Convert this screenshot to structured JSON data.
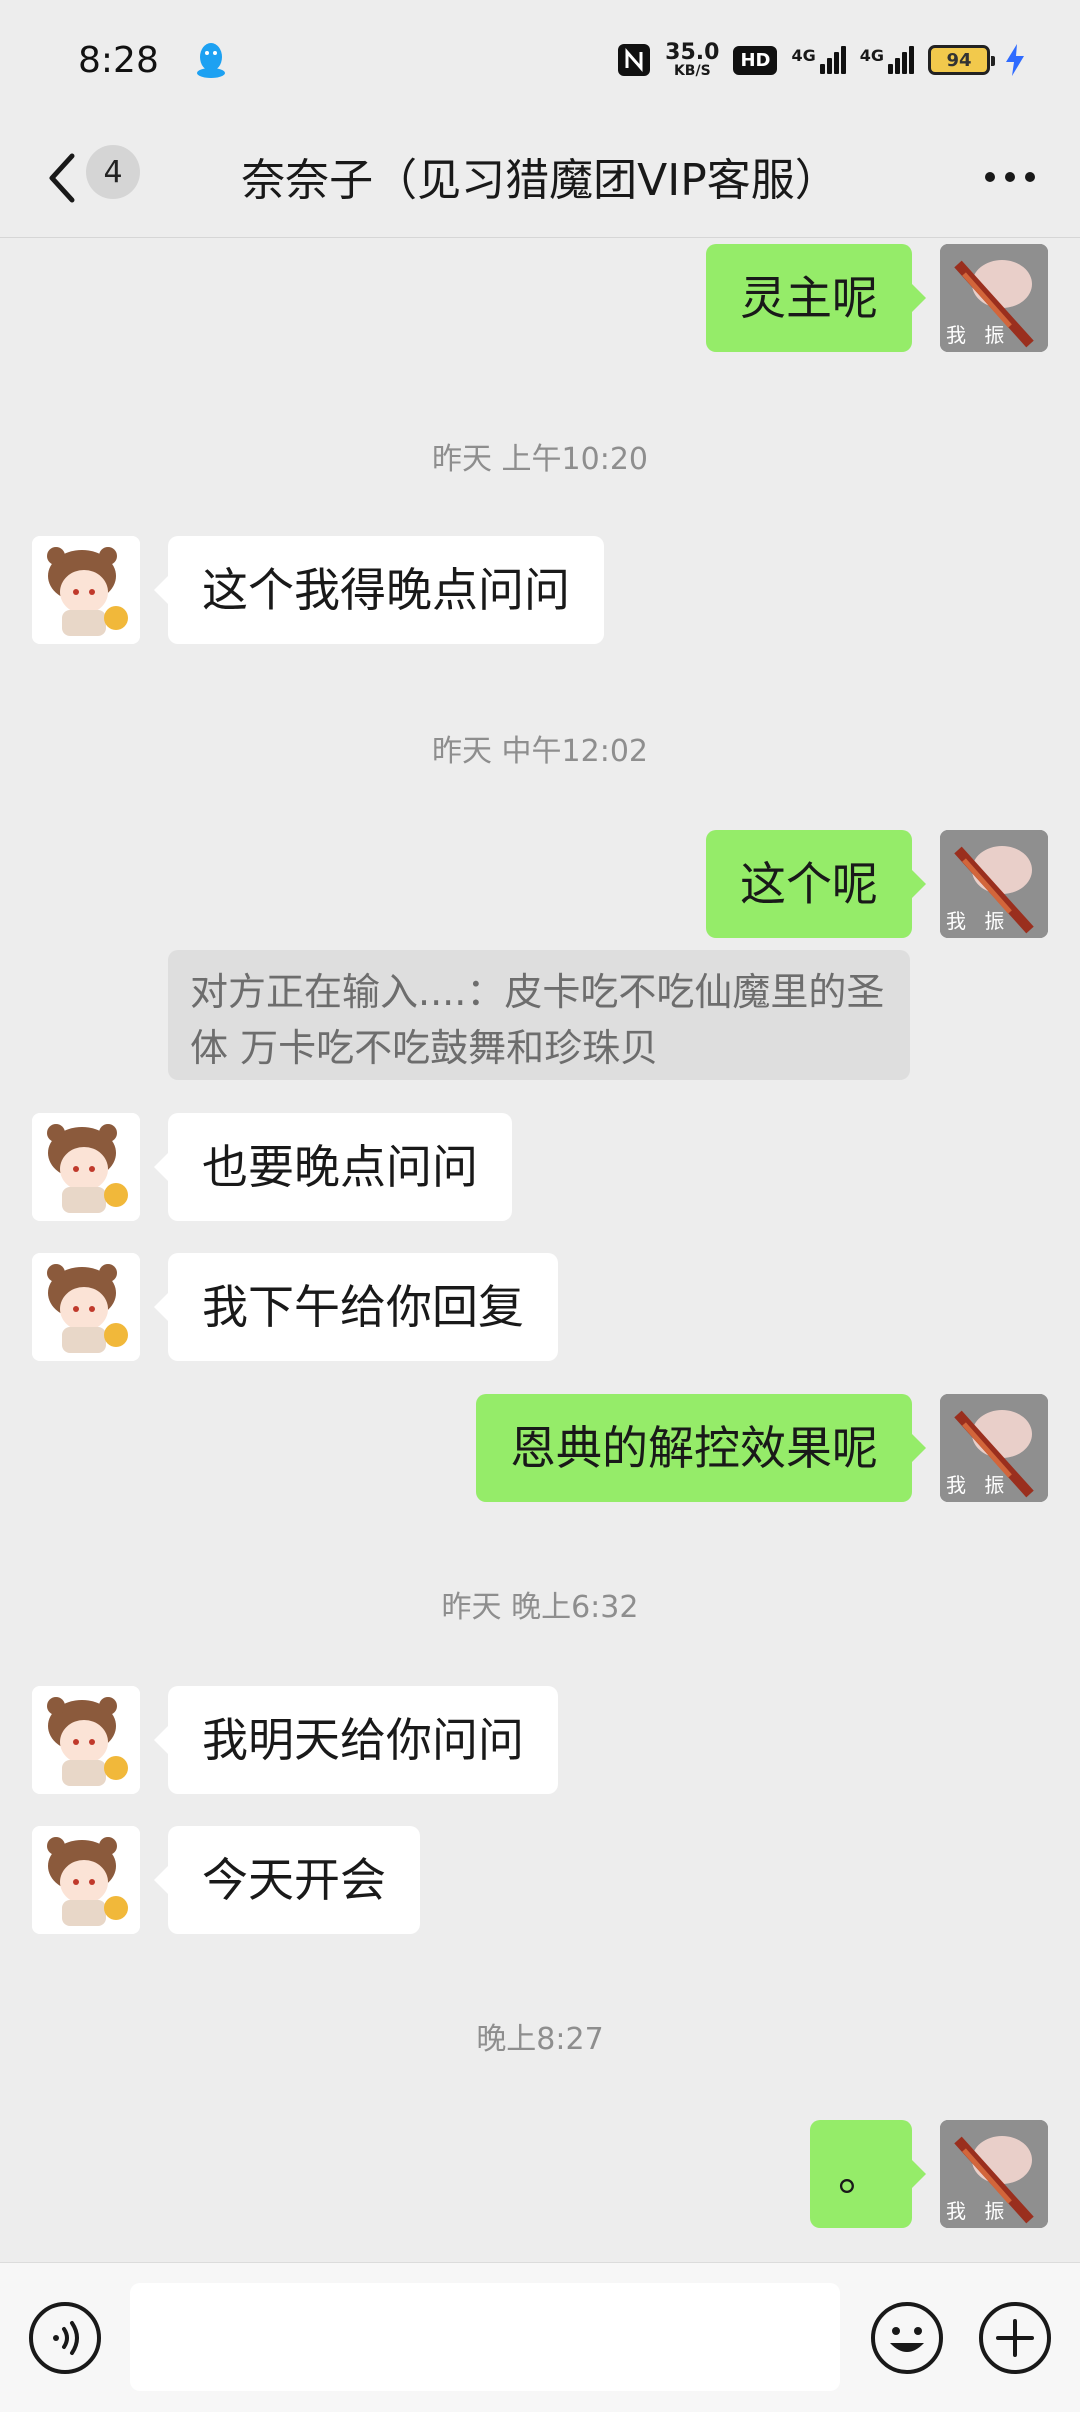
{
  "status": {
    "time": "8:28",
    "speed_value": "35.0",
    "speed_unit": "KB/S",
    "hd": "HD",
    "net1": "4G",
    "net2": "4G",
    "battery": "94"
  },
  "header": {
    "back_count": "4",
    "title": "奈奈子（见习猎魔团VIP客服）"
  },
  "avatar_label": "我 振",
  "messages": {
    "m1": "灵主呢",
    "t1": "昨天 上午10:20",
    "m2": "这个我得晚点问问",
    "t2": "昨天 中午12:02",
    "m3": "这个呢",
    "typing": "对方正在输入....：皮卡吃不吃仙魔里的圣体 万卡吃不吃鼓舞和珍珠贝",
    "m4": "也要晚点问问",
    "m5": "我下午给你回复",
    "m6": "恩典的解控效果呢",
    "t3": "昨天 晚上6:32",
    "m7": "我明天给你问问",
    "m8": "今天开会",
    "t4": "晚上8:27",
    "m9": "。"
  },
  "colors": {
    "sent_bubble": "#95ec69",
    "received_bubble": "#ffffff",
    "background": "#ededed"
  },
  "icons": [
    "qq-icon",
    "nfc-icon",
    "charging-bolt-icon",
    "back-chevron-icon",
    "more-icon",
    "voice-icon",
    "emoji-icon",
    "plus-icon"
  ]
}
